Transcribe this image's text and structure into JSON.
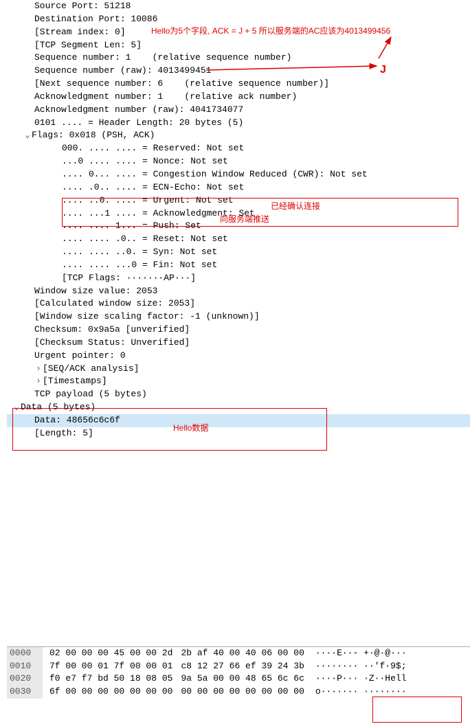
{
  "tcp": {
    "src_port": "Source Port: 51218",
    "dst_port": "Destination Port: 10086",
    "stream": "[Stream index: 0]",
    "seg_len": "[TCP Segment Len: 5]",
    "seq_rel": "Sequence number: 1    (relative sequence number)",
    "seq_raw": "Sequence number (raw): 4013499451",
    "next_seq": "[Next sequence number: 6    (relative sequence number)]",
    "ack_rel": "Acknowledgment number: 1    (relative ack number)",
    "ack_raw": "Acknowledgment number (raw): 4041734077",
    "hdr_len": "0101 .... = Header Length: 20 bytes (5)",
    "flags_title": "Flags: 0x018 (PSH, ACK)",
    "flag_reserved": "000. .... .... = Reserved: Not set",
    "flag_nonce": "...0 .... .... = Nonce: Not set",
    "flag_cwr": ".... 0... .... = Congestion Window Reduced (CWR): Not set",
    "flag_ecn": ".... .0.. .... = ECN-Echo: Not set",
    "flag_urg": ".... ..0. .... = Urgent: Not set",
    "flag_ack": ".... ...1 .... = Acknowledgment: Set",
    "flag_psh": ".... .... 1... = Push: Set",
    "flag_rst": ".... .... .0.. = Reset: Not set",
    "flag_syn": ".... .... ..0. = Syn: Not set",
    "flag_fin": ".... .... ...0 = Fin: Not set",
    "flags_sum": "[TCP Flags: ·······AP···]",
    "win_size": "Window size value: 2053",
    "win_calc": "[Calculated window size: 2053]",
    "win_scale": "[Window size scaling factor: -1 (unknown)]",
    "checksum": "Checksum: 0x9a5a [unverified]",
    "checksum_status": "[Checksum Status: Unverified]",
    "urgent": "Urgent pointer: 0",
    "seqack": "[SEQ/ACK analysis]",
    "timestamps": "[Timestamps]",
    "payload": "TCP payload (5 bytes)"
  },
  "data": {
    "title": "Data (5 bytes)",
    "value": "Data: 48656c6c6f",
    "length": "[Length: 5]"
  },
  "annotations": {
    "hello_note": "Hello为5个字段, ACK = J + 5 所以服务端的AC应该为4013499456",
    "letter_j": "J",
    "ack_connected": "已经确认连接",
    "push_to_server": "向服务端推送",
    "hello_data": "Hello数据"
  },
  "hex": {
    "rows": [
      {
        "off": "0000",
        "b1": "02 00 00 00 45 00 00 2d",
        "b2": "2b af 40 00 40 06 00 00",
        "asc": "····E··- +·@·@···"
      },
      {
        "off": "0010",
        "b1": "7f 00 00 01 7f 00 00 01",
        "b2": "c8 12 27 66 ef 39 24 3b",
        "asc": "········ ··'f·9$;"
      },
      {
        "off": "0020",
        "b1": "f0 e7 f7 bd 50 18 08 05",
        "b2": "9a 5a 00 00 48 65 6c 6c",
        "asc": "····P··· ·Z··Hell"
      },
      {
        "off": "0030",
        "b1": "6f 00 00 00 00 00 00 00",
        "b2": "00 00 00 00 00 00 00 00",
        "asc": "o······· ········"
      }
    ]
  }
}
